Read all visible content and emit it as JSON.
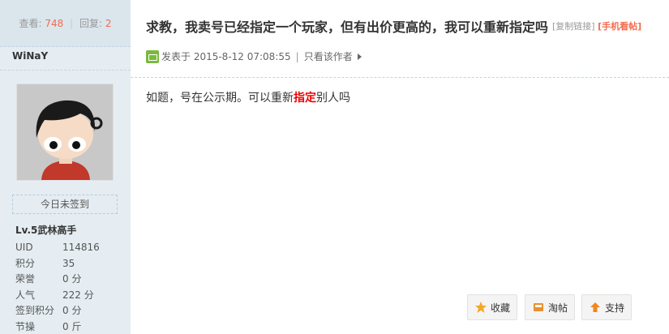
{
  "stats": {
    "views_label": "查看:",
    "views": "748",
    "replies_label": "回复:",
    "replies": "2"
  },
  "user": {
    "name": "WiNaY",
    "checkin": "今日未签到",
    "level": "Lv.5武林高手",
    "fields": [
      {
        "key": "UID",
        "value": "114816"
      },
      {
        "key": "积分",
        "value": "35"
      },
      {
        "key": "荣誉",
        "value": "0 分"
      },
      {
        "key": "人气",
        "value": "222 分"
      },
      {
        "key": "签到积分",
        "value": "0 分"
      },
      {
        "key": "节操",
        "value": "0 斤"
      }
    ]
  },
  "post": {
    "title": "求教，我卖号已经指定一个玩家，但有出价更高的，我可以重新指定吗",
    "copy_link": "[复制链接]",
    "mobile_link": "[手机看帖]",
    "posted_label": "发表于 2015-8-12 07:08:55",
    "only_author": "只看该作者",
    "content_before": "如题，号在公示期。可以重新",
    "content_highlight": "指定",
    "content_after": "别人吗"
  },
  "actions": {
    "favorite": "收藏",
    "tao": "淘帖",
    "support": "支持"
  },
  "colors": {
    "sidebar_bg": "#e5edf2",
    "accent": "#f26c4f",
    "highlight": "#ee0000"
  }
}
